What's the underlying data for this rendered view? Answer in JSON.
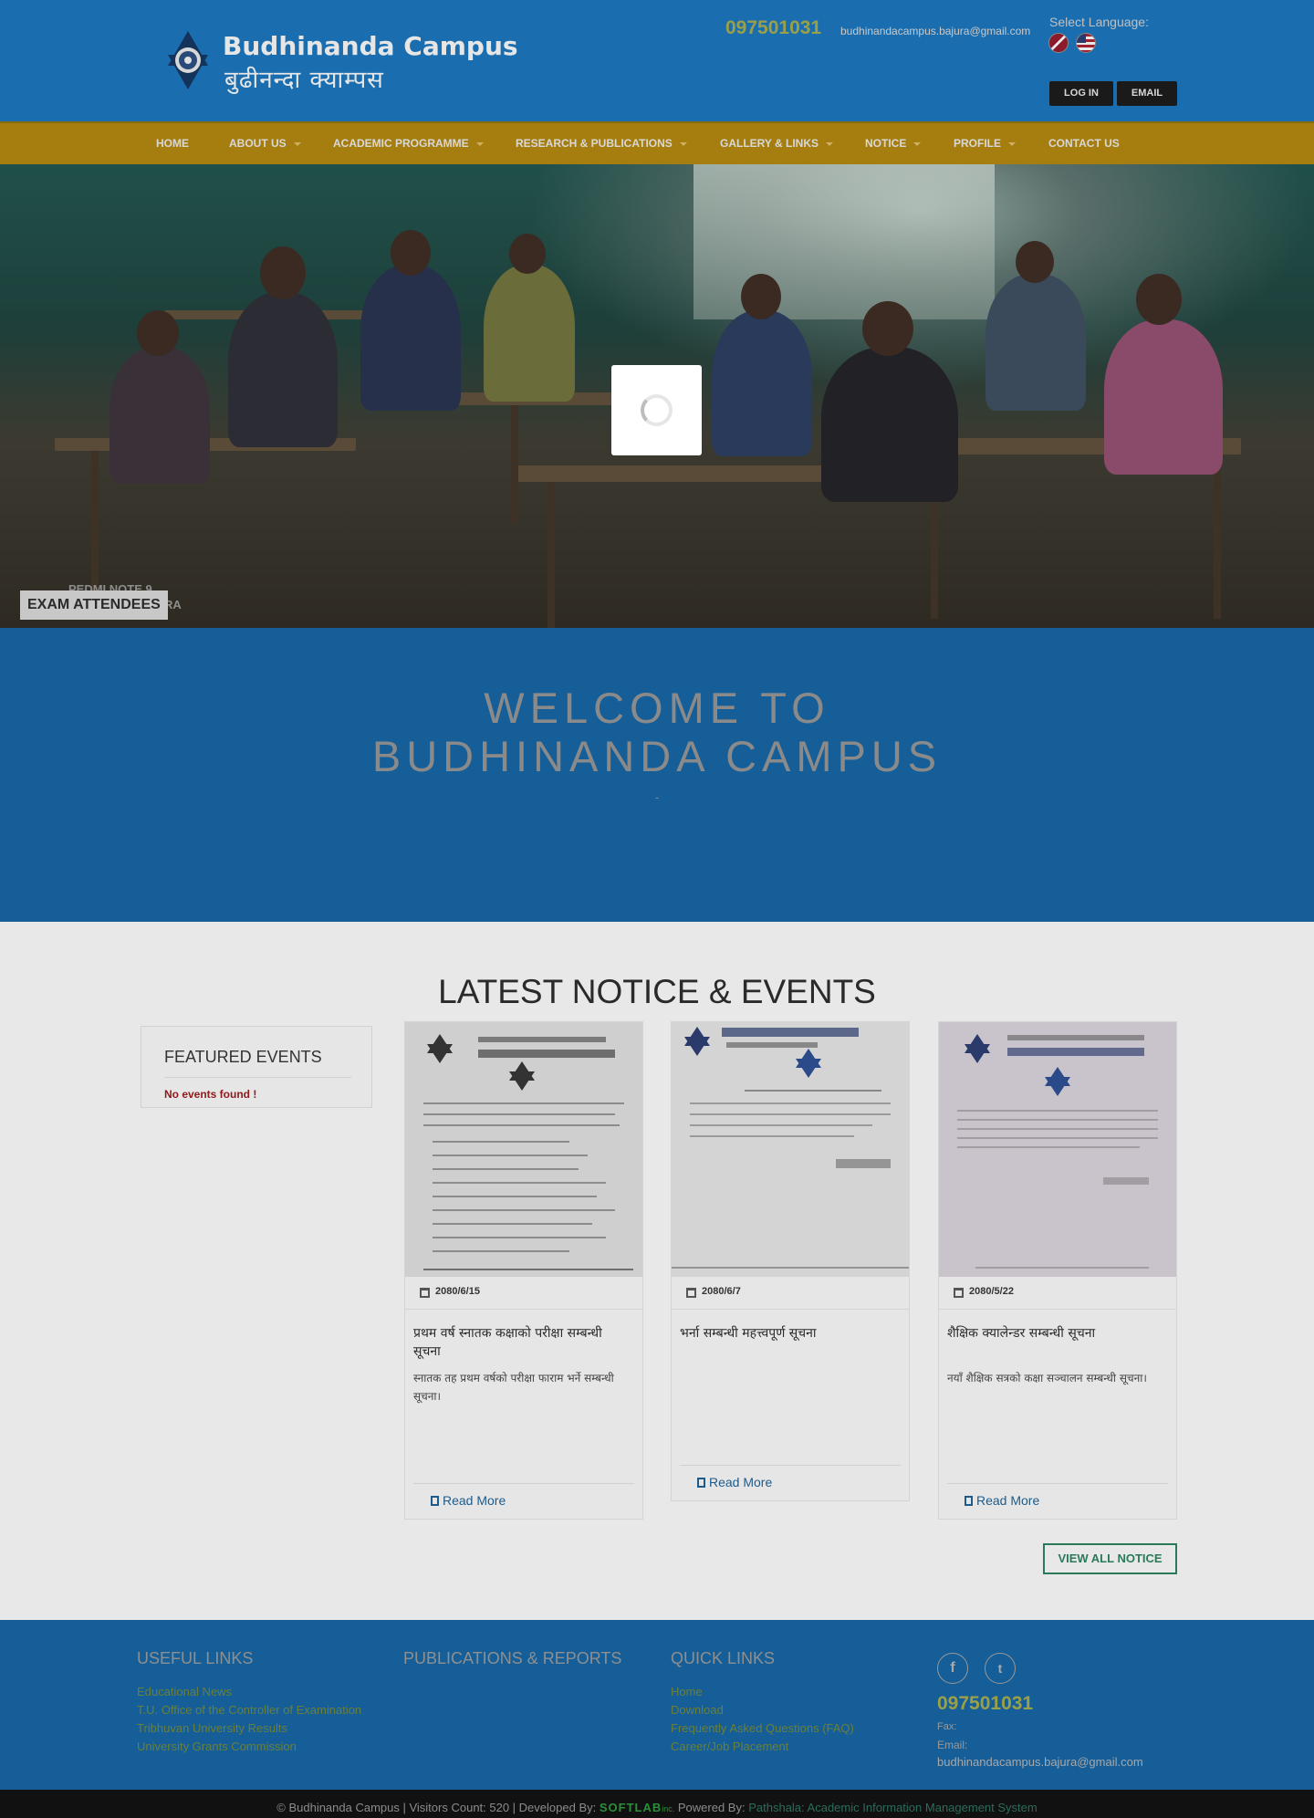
{
  "header": {
    "logo_en": "Budhinanda Campus",
    "logo_np": "बुढीनन्दा क्याम्पस",
    "phone": "097501031",
    "email": "budhinandacampus.bajura@gmail.com",
    "language_label": "Select Language:",
    "languages": [
      "nepali-flag-icon",
      "us-flag-icon"
    ],
    "login_label": "LOG IN",
    "email_label": "EMAIL"
  },
  "nav": {
    "items": [
      {
        "label": "HOME",
        "dropdown": false
      },
      {
        "label": "ABOUT US",
        "dropdown": true
      },
      {
        "label": "ACADEMIC PROGRAMME",
        "dropdown": true
      },
      {
        "label": "RESEARCH & PUBLICATIONS",
        "dropdown": true
      },
      {
        "label": "GALLERY & LINKS",
        "dropdown": true
      },
      {
        "label": "NOTICE",
        "dropdown": true
      },
      {
        "label": "PROFILE",
        "dropdown": true
      },
      {
        "label": "CONTACT US",
        "dropdown": false
      }
    ]
  },
  "hero": {
    "caption": "EXAM ATTENDEES",
    "ghost_caption_1": "PEDMI NOTE 9",
    "ghost_caption_2": "RA"
  },
  "welcome": {
    "line1": "WELCOME TO",
    "line2": "BUDHINANDA CAMPUS",
    "sub": "-"
  },
  "notices": {
    "title": "LATEST NOTICE & EVENTS",
    "featured_title": "FEATURED EVENTS",
    "featured_empty": "No events found !",
    "cards": [
      {
        "date": "2080/6/15",
        "title": "प्रथम वर्ष स्नातक कक्षाको परीक्षा सम्बन्धी सूचना",
        "desc": "स्नातक तह प्रथम वर्षको परीक्षा फाराम भर्ने सम्बन्धी सूचना।",
        "read_more": "Read More"
      },
      {
        "date": "2080/6/7",
        "title": "भर्ना सम्बन्धी महत्त्वपूर्ण सूचना",
        "desc": "",
        "read_more": "Read More"
      },
      {
        "date": "2080/5/22",
        "title": "शैक्षिक क्यालेन्डर सम्बन्धी सूचना",
        "desc": "नयाँ शैक्षिक सत्रको कक्षा सञ्चालन सम्बन्धी सूचना।",
        "read_more": "Read More"
      }
    ],
    "view_all": "VIEW ALL NOTICE"
  },
  "footer": {
    "useful_links_title": "USEFUL LINKS",
    "useful_links": [
      "Educational News",
      "T.U. Office of the Controller of Examination",
      "Tribhuvan University Results",
      "University Grants Commission"
    ],
    "publications_title": "PUBLICATIONS & REPORTS",
    "quick_links_title": "QUICK LINKS",
    "quick_links": [
      "Home",
      "Download",
      "Frequently Asked Questions (FAQ)",
      "Career/Job Placement"
    ],
    "social": [
      "facebook-icon",
      "twitter-icon"
    ],
    "phone": "097501031",
    "fax_label": "Fax:",
    "email_label": "Email:",
    "email": "budhinandacampus.bajura@gmail.com"
  },
  "bottom": {
    "copyright": "© Budhinanda Campus | Visitors Count: 520 | Developed By:",
    "developer": "SOFTLAB",
    "developer_suffix": "inc.",
    "powered_label": "Powered By:",
    "powered": "Pathshala: Academic Information Management System"
  }
}
